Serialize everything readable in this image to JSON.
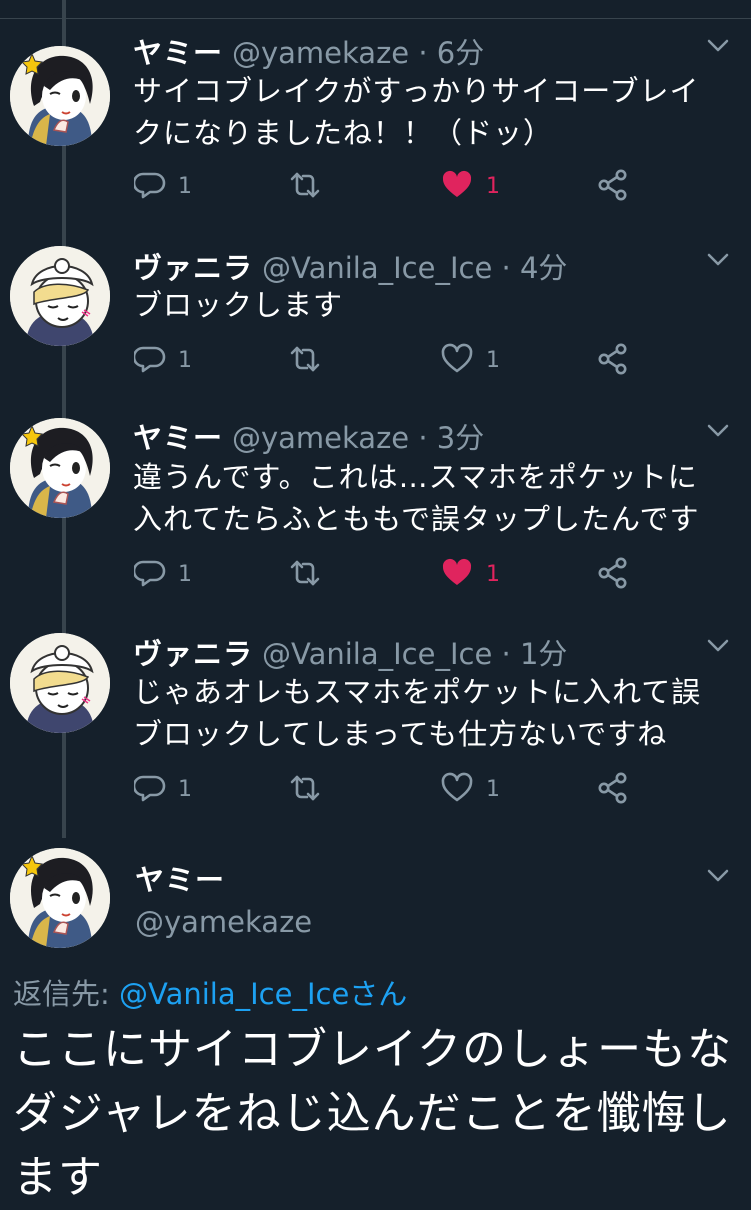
{
  "colors": {
    "background": "#15202b",
    "text": "#ffffff",
    "secondary": "#8899a6",
    "link": "#1da1f2",
    "like": "#e0245e",
    "thread_line": "#38444d"
  },
  "tweets": [
    {
      "name": "ヤミー",
      "handle": "@yamekaze · 6分",
      "text": "サイコブレイクがすっかりサイコーブレイ\nクになりましたね！！（ドッ）",
      "reply_count": "1",
      "like_count": "1",
      "liked": true,
      "avatar_icon": "character-avatar-yamekaze"
    },
    {
      "name": "ヴァニラ",
      "handle": "@Vanila_Ice_Ice · 4分",
      "text": "ブロックします",
      "reply_count": "1",
      "like_count": "1",
      "liked": false,
      "avatar_icon": "character-avatar-vanila"
    },
    {
      "name": "ヤミー",
      "handle": "@yamekaze · 3分",
      "text": "違うんです。これは…スマホをポケットに\n入れてたらふとももで誤タップしたんです",
      "reply_count": "1",
      "like_count": "1",
      "liked": true,
      "avatar_icon": "character-avatar-yamekaze"
    },
    {
      "name": "ヴァニラ",
      "handle": "@Vanila_Ice_Ice · 1分",
      "text": "じゃあオレもスマホをポケットに入れて誤\nブロックしてしまっても仕方ないですね",
      "reply_count": "1",
      "like_count": "1",
      "liked": false,
      "avatar_icon": "character-avatar-vanila"
    }
  ],
  "focused": {
    "name": "ヤミー",
    "handle": "@yamekaze",
    "reply_label": "返信先: ",
    "reply_to": "@Vanila_Ice_Iceさん",
    "text": "ここにサイコブレイクのしょーもな\nダジャレをねじ込んだことを懺悔し\nます",
    "avatar_icon": "character-avatar-yamekaze"
  }
}
